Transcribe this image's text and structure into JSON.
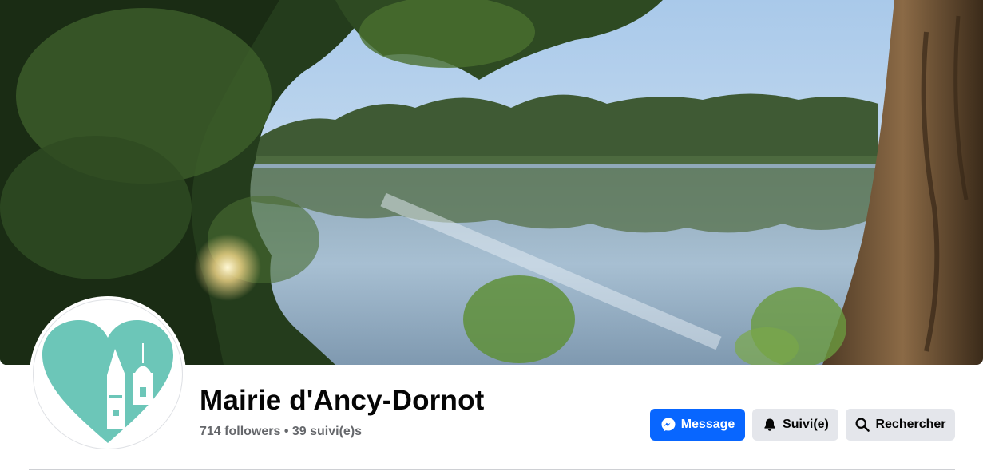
{
  "page": {
    "title": "Mairie d'Ancy-Dornot",
    "followers": "714 followers",
    "separator": "•",
    "following": "39 suivi(e)s"
  },
  "actions": {
    "message_label": "Message",
    "follow_label": "Suivi(e)",
    "search_label": "Rechercher"
  },
  "icons": {
    "message": "messenger-icon",
    "follow": "bell-icon",
    "search": "search-icon"
  },
  "colors": {
    "primary": "#0866ff",
    "secondary": "#e4e6eb",
    "logo_teal": "#6cc6b8"
  }
}
